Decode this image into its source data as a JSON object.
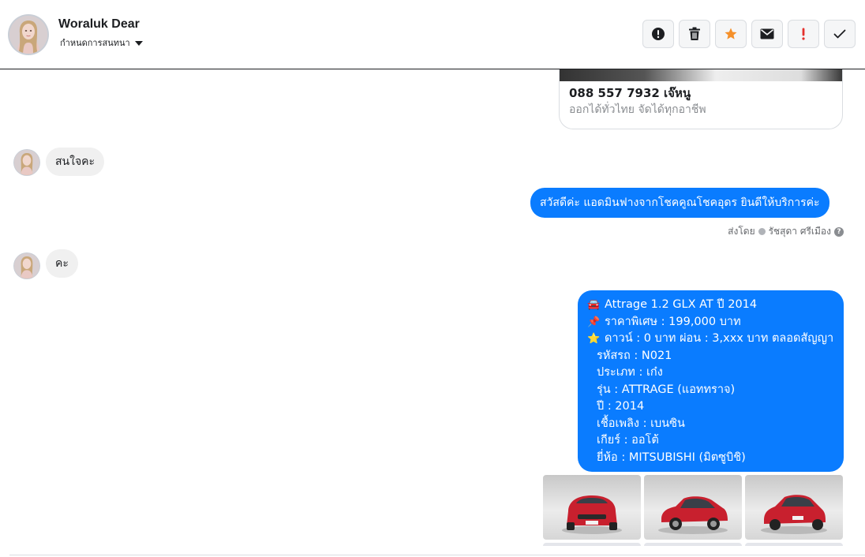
{
  "header": {
    "contact_name": "Woraluk Dear",
    "assign_label": "กำหนดการสนทนา",
    "actions": [
      {
        "name": "spam-icon",
        "label": "!"
      },
      {
        "name": "trash-icon"
      },
      {
        "name": "star-icon"
      },
      {
        "name": "envelope-icon"
      },
      {
        "name": "follow-up-icon",
        "label": "!"
      },
      {
        "name": "check-icon"
      }
    ]
  },
  "link_card": {
    "title": "088 557 7932 เจ๊หนู",
    "subtitle": "ออกได้ทั่วไทย จัดได้ทุกอาชีพ"
  },
  "messages": {
    "in_1": "สนใจคะ",
    "out_1": "สวัสดีค่ะ แอดมินฟางจากโชคคูณโชคอุดร ยินดีให้บริการค่ะ",
    "sent_by_prefix": "ส่งโดย",
    "sent_by_name": "รัชสุดา ศรีเมือง",
    "in_2": "คะ"
  },
  "car_detail": {
    "lines": [
      {
        "emoji": "🚘",
        "text": "Attrage 1.2 GLX AT ปี 2014"
      },
      {
        "emoji": "📌",
        "text": "ราคาพิเศษ : 199,000 บาท"
      },
      {
        "emoji": "⭐",
        "text": "ดาวน์ : 0 บาท ผ่อน : 3,xxx บาท ตลอดสัญญา"
      },
      {
        "emoji": "",
        "text": "รหัสรถ : N021"
      },
      {
        "emoji": "",
        "text": "ประเภท : เก๋ง"
      },
      {
        "emoji": "",
        "text": "รุ่น : ATTRAGE (แอททราจ)"
      },
      {
        "emoji": "",
        "text": "ปี : 2014"
      },
      {
        "emoji": "",
        "text": "เชื้อเพลิง : เบนซิน"
      },
      {
        "emoji": "",
        "text": "เกียร์ : ออโต้"
      },
      {
        "emoji": "",
        "text": "ยี่ห้อ : MITSUBISHI (มิตซูบิชิ)"
      }
    ]
  },
  "colors": {
    "accent": "#0a7cff",
    "star": "#f5902a",
    "follow_up": "#e4302c",
    "car_red": "#c8202e"
  }
}
